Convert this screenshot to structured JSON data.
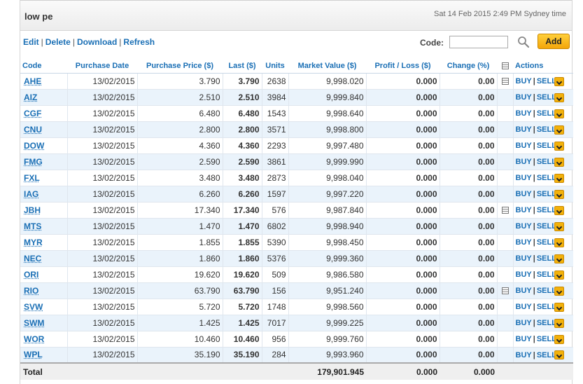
{
  "header": {
    "portfolio_name": "low pe",
    "timestamp": "Sat 14 Feb 2015 2:49 PM Sydney time"
  },
  "toolbar": {
    "edit": "Edit",
    "delete": "Delete",
    "download": "Download",
    "refresh": "Refresh",
    "code_label": "Code:",
    "code_value": "",
    "add": "Add"
  },
  "columns": {
    "code": "Code",
    "purchase_date": "Purchase Date",
    "purchase_price": "Purchase Price ($)",
    "last": "Last ($)",
    "units": "Units",
    "market_value": "Market Value ($)",
    "profit_loss": "Profit / Loss ($)",
    "change": "Change (%)",
    "actions": "Actions"
  },
  "actions": {
    "buy": "BUY",
    "sell": "SELL"
  },
  "rows": [
    {
      "code": "AHE",
      "date": "13/02/2015",
      "price": "3.790",
      "last": "3.790",
      "units": "2638",
      "value": "9,998.020",
      "pl": "0.000",
      "change": "0.00",
      "note": true
    },
    {
      "code": "AIZ",
      "date": "13/02/2015",
      "price": "2.510",
      "last": "2.510",
      "units": "3984",
      "value": "9,999.840",
      "pl": "0.000",
      "change": "0.00",
      "note": false
    },
    {
      "code": "CGF",
      "date": "13/02/2015",
      "price": "6.480",
      "last": "6.480",
      "units": "1543",
      "value": "9,998.640",
      "pl": "0.000",
      "change": "0.00",
      "note": false
    },
    {
      "code": "CNU",
      "date": "13/02/2015",
      "price": "2.800",
      "last": "2.800",
      "units": "3571",
      "value": "9,998.800",
      "pl": "0.000",
      "change": "0.00",
      "note": false
    },
    {
      "code": "DOW",
      "date": "13/02/2015",
      "price": "4.360",
      "last": "4.360",
      "units": "2293",
      "value": "9,997.480",
      "pl": "0.000",
      "change": "0.00",
      "note": false
    },
    {
      "code": "FMG",
      "date": "13/02/2015",
      "price": "2.590",
      "last": "2.590",
      "units": "3861",
      "value": "9,999.990",
      "pl": "0.000",
      "change": "0.00",
      "note": false
    },
    {
      "code": "FXL",
      "date": "13/02/2015",
      "price": "3.480",
      "last": "3.480",
      "units": "2873",
      "value": "9,998.040",
      "pl": "0.000",
      "change": "0.00",
      "note": false
    },
    {
      "code": "IAG",
      "date": "13/02/2015",
      "price": "6.260",
      "last": "6.260",
      "units": "1597",
      "value": "9,997.220",
      "pl": "0.000",
      "change": "0.00",
      "note": false
    },
    {
      "code": "JBH",
      "date": "13/02/2015",
      "price": "17.340",
      "last": "17.340",
      "units": "576",
      "value": "9,987.840",
      "pl": "0.000",
      "change": "0.00",
      "note": true
    },
    {
      "code": "MTS",
      "date": "13/02/2015",
      "price": "1.470",
      "last": "1.470",
      "units": "6802",
      "value": "9,998.940",
      "pl": "0.000",
      "change": "0.00",
      "note": false
    },
    {
      "code": "MYR",
      "date": "13/02/2015",
      "price": "1.855",
      "last": "1.855",
      "units": "5390",
      "value": "9,998.450",
      "pl": "0.000",
      "change": "0.00",
      "note": false
    },
    {
      "code": "NEC",
      "date": "13/02/2015",
      "price": "1.860",
      "last": "1.860",
      "units": "5376",
      "value": "9,999.360",
      "pl": "0.000",
      "change": "0.00",
      "note": false
    },
    {
      "code": "ORI",
      "date": "13/02/2015",
      "price": "19.620",
      "last": "19.620",
      "units": "509",
      "value": "9,986.580",
      "pl": "0.000",
      "change": "0.00",
      "note": false
    },
    {
      "code": "RIO",
      "date": "13/02/2015",
      "price": "63.790",
      "last": "63.790",
      "units": "156",
      "value": "9,951.240",
      "pl": "0.000",
      "change": "0.00",
      "note": true
    },
    {
      "code": "SVW",
      "date": "13/02/2015",
      "price": "5.720",
      "last": "5.720",
      "units": "1748",
      "value": "9,998.560",
      "pl": "0.000",
      "change": "0.00",
      "note": false
    },
    {
      "code": "SWM",
      "date": "13/02/2015",
      "price": "1.425",
      "last": "1.425",
      "units": "7017",
      "value": "9,999.225",
      "pl": "0.000",
      "change": "0.00",
      "note": false
    },
    {
      "code": "WOR",
      "date": "13/02/2015",
      "price": "10.460",
      "last": "10.460",
      "units": "956",
      "value": "9,999.760",
      "pl": "0.000",
      "change": "0.00",
      "note": false
    },
    {
      "code": "WPL",
      "date": "13/02/2015",
      "price": "35.190",
      "last": "35.190",
      "units": "284",
      "value": "9,993.960",
      "pl": "0.000",
      "change": "0.00",
      "note": false
    }
  ],
  "total": {
    "label": "Total",
    "value": "179,901.945",
    "pl": "0.000",
    "change": "0.000"
  }
}
